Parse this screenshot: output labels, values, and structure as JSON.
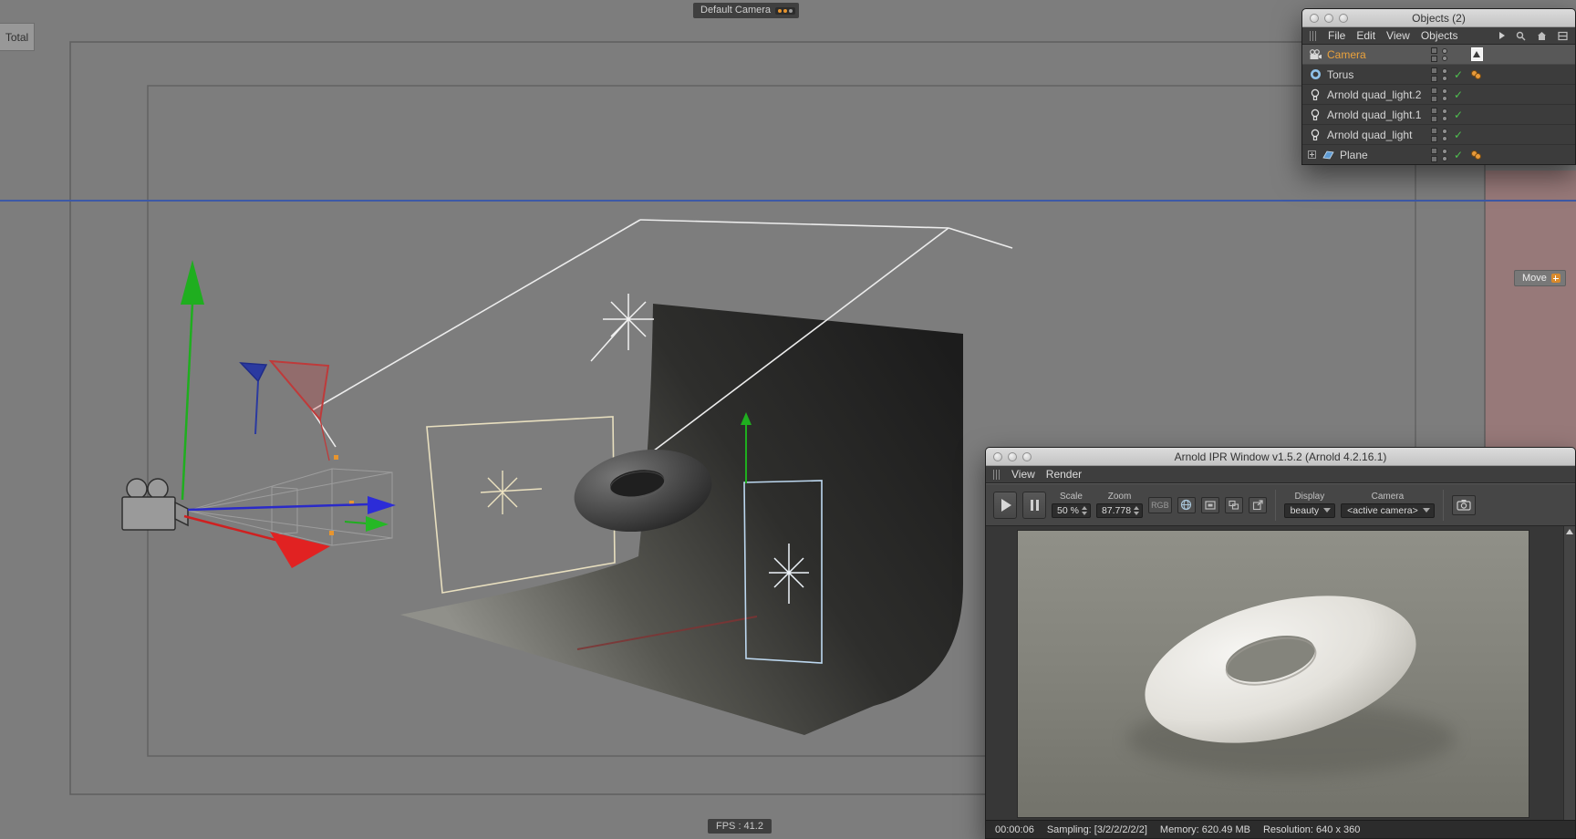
{
  "viewport": {
    "camera_label": "Default Camera",
    "total_label": "Total",
    "fps_label": "FPS : 41.2",
    "move_label": "Move"
  },
  "objects_panel": {
    "title": "Objects (2)",
    "menu_items": [
      "File",
      "Edit",
      "View",
      "Objects"
    ],
    "rows": [
      {
        "label": "Camera"
      },
      {
        "label": "Torus"
      },
      {
        "label": "Arnold quad_light.2"
      },
      {
        "label": "Arnold quad_light.1"
      },
      {
        "label": "Arnold quad_light"
      },
      {
        "label": "Plane"
      }
    ]
  },
  "ipr_window": {
    "title": "Arnold IPR Window v1.5.2 (Arnold 4.2.16.1)",
    "menu_items": [
      "View",
      "Render"
    ],
    "toolbar": {
      "scale_label": "Scale",
      "scale_value": "50 %",
      "zoom_label": "Zoom",
      "zoom_value": "87.778",
      "rgb_label": "RGB",
      "display_label": "Display",
      "display_value": "beauty",
      "camera_label": "Camera",
      "camera_value": "<active camera>"
    },
    "status": {
      "time": "00:00:06",
      "sampling": "Sampling: [3/2/2/2/2/2]",
      "memory": "Memory: 620.49 MB",
      "resolution": "Resolution: 640 x 360"
    }
  },
  "colors": {
    "selection_orange": "#e8a23c",
    "check_green": "#4fc14f",
    "guide_blue": "#3d59a6",
    "safe_area_tint": "#b27676",
    "axis_green": "#1fae1f",
    "axis_red": "#d42222",
    "axis_blue": "#2a2ac8"
  },
  "glyphs": {
    "check": "✓"
  }
}
